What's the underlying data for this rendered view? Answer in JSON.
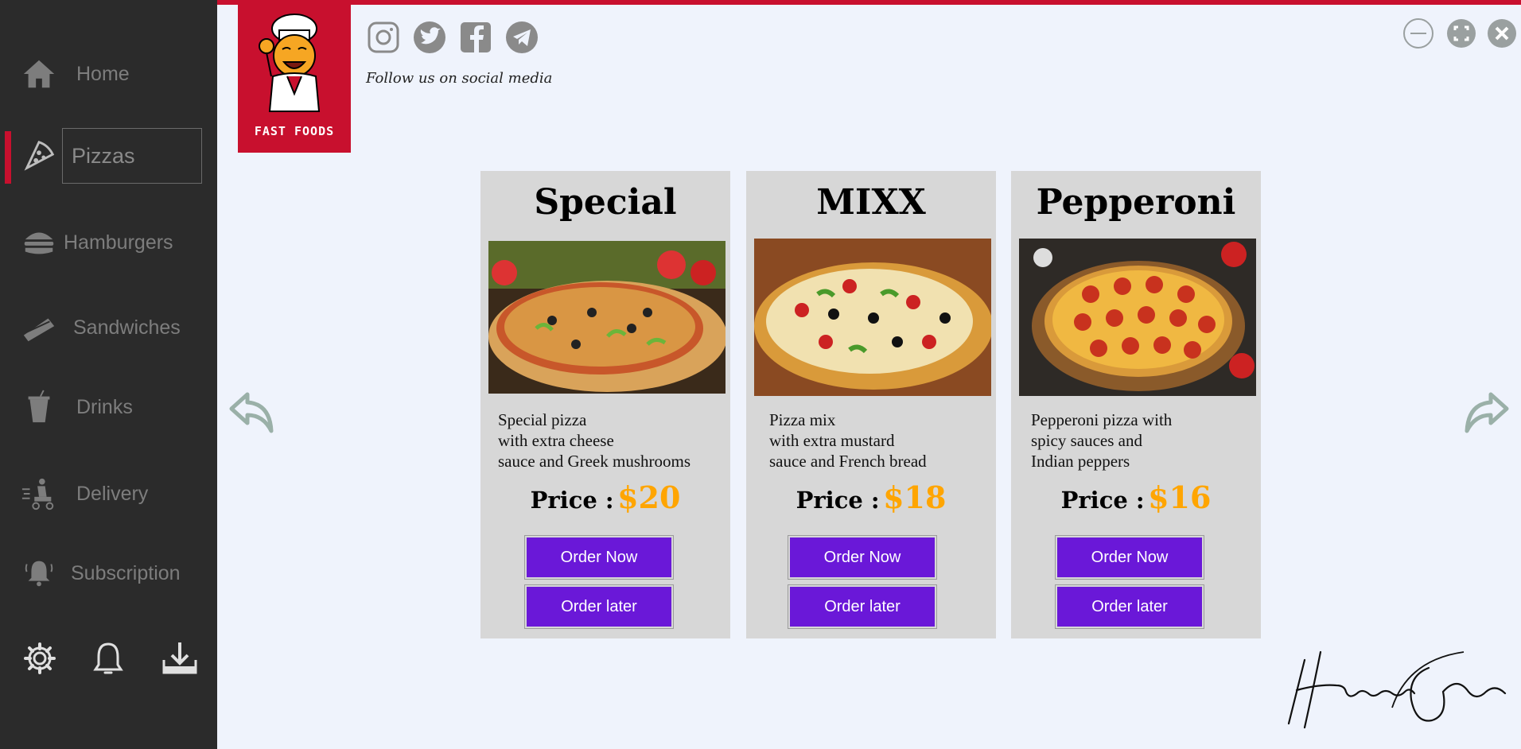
{
  "sidebar": {
    "items": [
      {
        "label": "Home",
        "icon": "home-icon"
      },
      {
        "label": "Pizzas",
        "icon": "pizza-icon",
        "active": true
      },
      {
        "label": "Hamburgers",
        "icon": "hamburger-icon"
      },
      {
        "label": "Sandwiches",
        "icon": "sandwich-icon"
      },
      {
        "label": "Drinks",
        "icon": "drink-icon"
      },
      {
        "label": "Delivery",
        "icon": "delivery-icon"
      },
      {
        "label": "Subscription",
        "icon": "subscription-bell-icon"
      }
    ],
    "bottom_icons": [
      "gear-icon",
      "bell-icon",
      "download-icon"
    ]
  },
  "brand": {
    "logo_text": "FAST FOODS",
    "accent_color": "#c8102e"
  },
  "social": {
    "follow_text": "Follow us on social media",
    "icons": [
      "instagram-icon",
      "twitter-icon",
      "facebook-icon",
      "telegram-icon"
    ]
  },
  "window_controls": [
    "minimize-icon",
    "maximize-icon",
    "close-icon"
  ],
  "cards": [
    {
      "title": "Special",
      "desc": [
        "Special pizza",
        "with extra cheese",
        "sauce and Greek mushrooms"
      ],
      "price_label": "Price :",
      "price": "$20",
      "order_now": "Order Now",
      "order_later": "Order later"
    },
    {
      "title": "MIXX",
      "desc": [
        "Pizza mix",
        "with extra mustard",
        "sauce and French bread"
      ],
      "price_label": "Price :",
      "price": "$18",
      "order_now": "Order Now",
      "order_later": "Order later"
    },
    {
      "title": "Pepperoni",
      "desc": [
        "Pepperoni pizza with",
        "spicy sauces and",
        "Indian peppers"
      ],
      "price_label": "Price :",
      "price": "$16",
      "order_now": "Order Now",
      "order_later": "Order later"
    }
  ],
  "colors": {
    "button": "#6a18d8",
    "price": "#ffa500",
    "sidebar_bg": "#2b2b2b",
    "page_bg": "#eff3fc",
    "card_bg": "#d7d7d7"
  },
  "signature": "Hossein Saeidian"
}
